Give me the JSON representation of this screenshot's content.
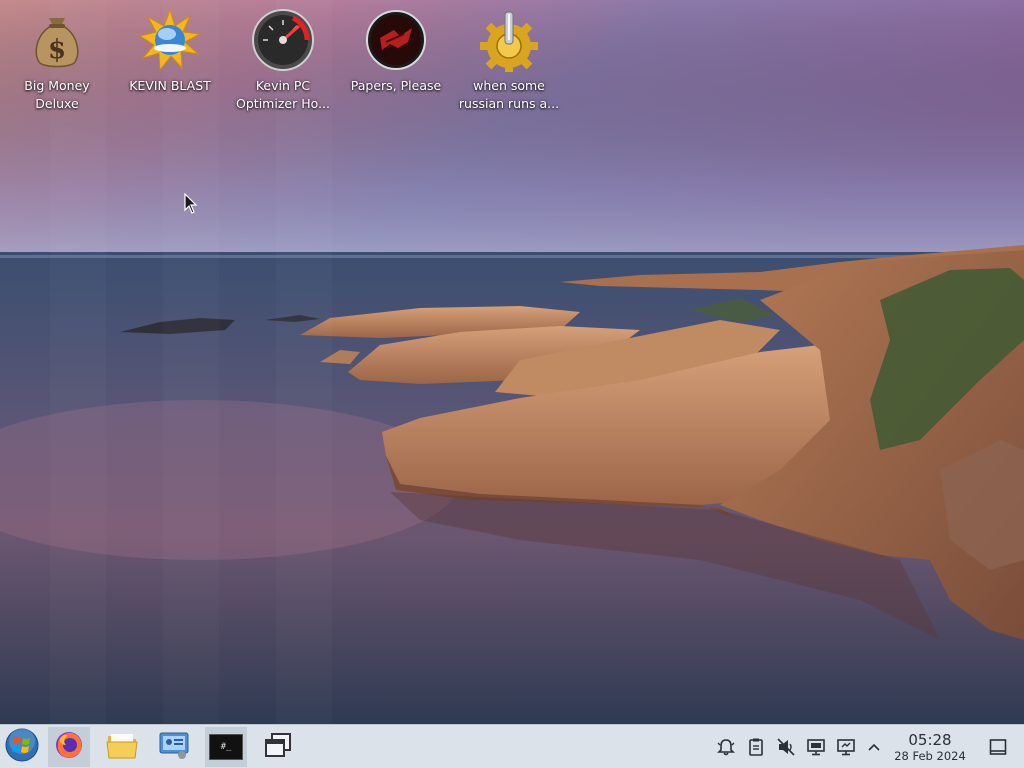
{
  "desktop": {
    "icons": [
      {
        "label": "Big Money\nDeluxe",
        "icon": "money-bag-icon"
      },
      {
        "label": "KEVIN BLAST",
        "icon": "globe-burst-icon"
      },
      {
        "label": "Kevin PC\nOptimizer Ho...",
        "icon": "speedometer-icon"
      },
      {
        "label": "Papers, Please",
        "icon": "papers-please-icon"
      },
      {
        "label": "when some\nrussian runs a...",
        "icon": "gear-joystick-icon"
      }
    ]
  },
  "taskbar": {
    "launchers": [
      {
        "name": "start-menu-button",
        "icon": "windows-orb-icon"
      },
      {
        "name": "firefox-button",
        "icon": "firefox-icon"
      },
      {
        "name": "file-manager-button",
        "icon": "folder-icon"
      },
      {
        "name": "system-settings-button",
        "icon": "control-panel-icon"
      },
      {
        "name": "terminal-button",
        "icon": "terminal-icon"
      },
      {
        "name": "window-switcher-button",
        "icon": "windows-overlap-icon"
      }
    ],
    "terminal_prompt": "#_",
    "tray": [
      "notifications-icon",
      "clipboard-icon",
      "volume-muted-icon",
      "display-icon",
      "network-icon",
      "tray-expand-icon"
    ],
    "clock": {
      "time": "05:28",
      "date": "28 Feb 2024"
    },
    "show_desktop": "show-desktop-icon"
  },
  "colors": {
    "taskbar_bg": "#dbe2ea",
    "sky_top": "#8c6fa8",
    "sea": "#3d4a66",
    "rock": "#c08a62"
  }
}
